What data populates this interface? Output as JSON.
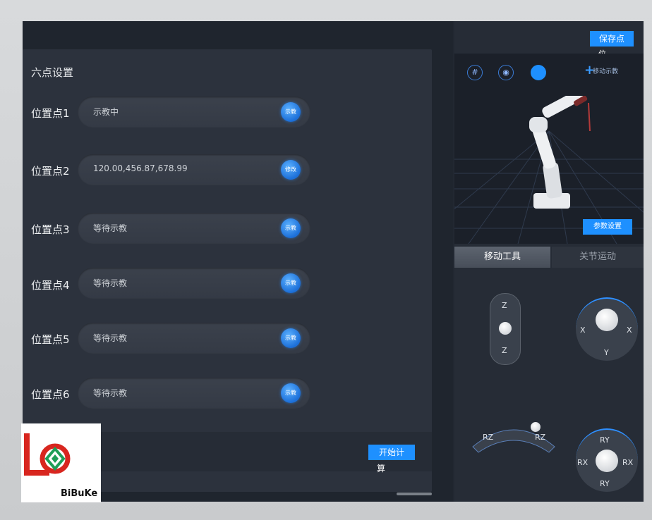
{
  "panel": {
    "title": "六点设置",
    "rows": [
      {
        "label": "位置点1",
        "value": "示教中",
        "btn": "示教"
      },
      {
        "label": "位置点2",
        "value": "120.00,456.87,678.99",
        "btn": "修改"
      },
      {
        "label": "位置点3",
        "value": "等待示教",
        "btn": "示教"
      },
      {
        "label": "位置点4",
        "value": "等待示教",
        "btn": "示教"
      },
      {
        "label": "位置点5",
        "value": "等待示教",
        "btn": "示教"
      },
      {
        "label": "位置点6",
        "value": "等待示教",
        "btn": "示教"
      }
    ],
    "calc_button_line1": "开始计",
    "calc_button_line2": "算"
  },
  "right": {
    "save_line1": "保存点",
    "save_line2": "位",
    "grid_icon": "#",
    "eye_icon": "◉",
    "move_teach_label": "移动示教",
    "param_button": "参数设置",
    "tabs": [
      "移动工具",
      "关节运动"
    ],
    "z_top": "Z",
    "z_bottom": "Z",
    "xy_left": "X",
    "xy_right": "X",
    "xy_bottom": "Y",
    "rz_left": "RZ",
    "rz_right": "RZ",
    "r_top": "RY",
    "r_left": "RX",
    "r_right": "RX",
    "r_bottom": "RY"
  },
  "logo": {
    "text": "BiBuKe"
  },
  "colors": {
    "accent": "#1e90ff",
    "panel": "#2c323d",
    "background": "#1f252e"
  }
}
